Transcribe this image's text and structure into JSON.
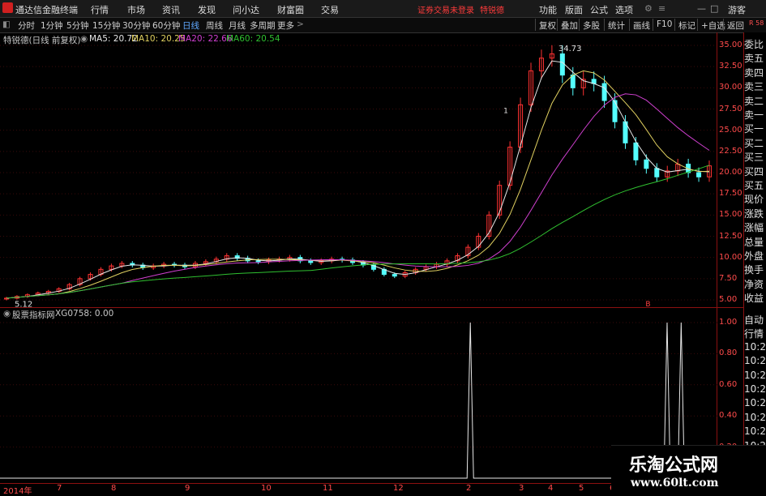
{
  "titlebar": {
    "app_title": "通达信金融终端",
    "menus": [
      "行情",
      "市场",
      "资讯",
      "发现",
      "问小达",
      "财富圈",
      "交易"
    ],
    "status_red": "证券交易未登录",
    "user_red": "特锐德",
    "right_menus": [
      "功能",
      "版面",
      "公式",
      "选项"
    ],
    "guest": "游客"
  },
  "toolbar": {
    "periods": [
      "分时",
      "1分钟",
      "5分钟",
      "15分钟",
      "30分钟",
      "60分钟",
      "日线",
      "周线",
      "月线",
      "多周期",
      "更多"
    ],
    "active_period": "日线",
    "right_buttons": [
      "复权",
      "叠加",
      "多股",
      "统计",
      "画线",
      "F10",
      "标记",
      "+自选",
      "返回"
    ]
  },
  "main_chart": {
    "stock_label": "特锐德(日线 前复权)",
    "ma5_label": "MA5: 20.72",
    "ma10_label": "MA10: 20.25",
    "ma20_label": "MA20: 22.66",
    "ma60_label": "MA60: 20.54",
    "high_label": "34.73",
    "low_label": "5.12",
    "marker_1": "1",
    "marker_b": "B",
    "colors": {
      "ma5": "#e8e8e8",
      "ma10": "#e0d060",
      "ma20": "#d040d0",
      "ma60": "#30c030",
      "up": "#ff3232",
      "down": "#54ffff"
    }
  },
  "sub_chart": {
    "indicator_name": "股票指标网",
    "value_label": "XG0758: 0.00"
  },
  "sidebar": {
    "items": [
      "委比",
      "卖五",
      "卖四",
      "卖三",
      "卖二",
      "卖一",
      "买一",
      "买二",
      "买三",
      "买四",
      "买五",
      "现价",
      "涨跌",
      "涨幅",
      "总量",
      "外盘",
      "换手",
      "净资",
      "收益"
    ],
    "bottom_items": [
      "自动",
      "行情",
      "10:2",
      "10:2",
      "10:2",
      "10:2",
      "10:2",
      "10:2",
      "10:2",
      "10:2"
    ],
    "top_small": "R 58"
  },
  "watermark": {
    "line1": "乐淘公式网",
    "line2": "www.60lt.com"
  },
  "chart_data": [
    {
      "type": "candlestick",
      "title": "特锐德(日线 前复权)",
      "y_ticks": [
        "35.00",
        "32.50",
        "30.00",
        "27.50",
        "25.00",
        "22.50",
        "20.00",
        "17.50",
        "15.00",
        "12.50",
        "10.00",
        "7.50",
        "5.00"
      ],
      "ylim": [
        5.0,
        35.0
      ],
      "x_ticks": [
        "2014年",
        "7",
        "8",
        "9",
        "10",
        "11",
        "12",
        "2",
        "3",
        "4",
        "5",
        "6"
      ],
      "annotations": [
        "34.73",
        "5.12"
      ],
      "close_series": [
        5.2,
        5.4,
        5.6,
        5.8,
        6.0,
        6.3,
        6.8,
        7.5,
        8.0,
        8.6,
        9.0,
        9.3,
        9.1,
        8.8,
        9.0,
        9.2,
        9.1,
        8.9,
        9.3,
        9.5,
        9.8,
        10.2,
        9.9,
        9.6,
        9.5,
        9.7,
        9.8,
        10.0,
        9.6,
        9.4,
        9.6,
        9.8,
        9.7,
        9.4,
        9.1,
        8.6,
        8.0,
        7.8,
        8.2,
        8.6,
        8.9,
        9.2,
        9.6,
        10.2,
        11.2,
        12.5,
        15.0,
        18.5,
        23.0,
        28.0,
        32.0,
        33.5,
        34.0,
        31.5,
        30.0,
        31.0,
        30.5,
        28.5,
        26.0,
        23.5,
        21.5,
        20.5,
        19.5,
        20.2,
        21.0,
        20.0,
        19.5,
        20.8
      ]
    },
    {
      "type": "line",
      "title": "XG0758",
      "y_ticks": [
        "1.00",
        "0.80",
        "0.60",
        "0.40",
        "0.20"
      ],
      "spike_positions": [
        0.66,
        0.94,
        0.96
      ]
    }
  ]
}
